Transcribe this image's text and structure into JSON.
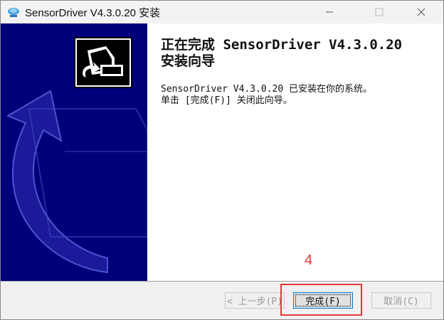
{
  "window": {
    "title": "SensorDriver V4.3.0.20 安装"
  },
  "main": {
    "heading": "正在完成 SensorDriver V4.3.0.20\n安装向导",
    "body": "SensorDriver V4.3.0.20 已安装在你的系统。\n单击 [完成(F)] 关闭此向导。"
  },
  "buttons": {
    "back_label": "< 上一步(P)",
    "finish_label": "完成(F)",
    "cancel_label": "取消(C)"
  },
  "annotation": {
    "step_number": "4",
    "color": "#e03a36"
  },
  "colors": {
    "banner": "#00007a",
    "titlebar": "#f3f3f3"
  }
}
